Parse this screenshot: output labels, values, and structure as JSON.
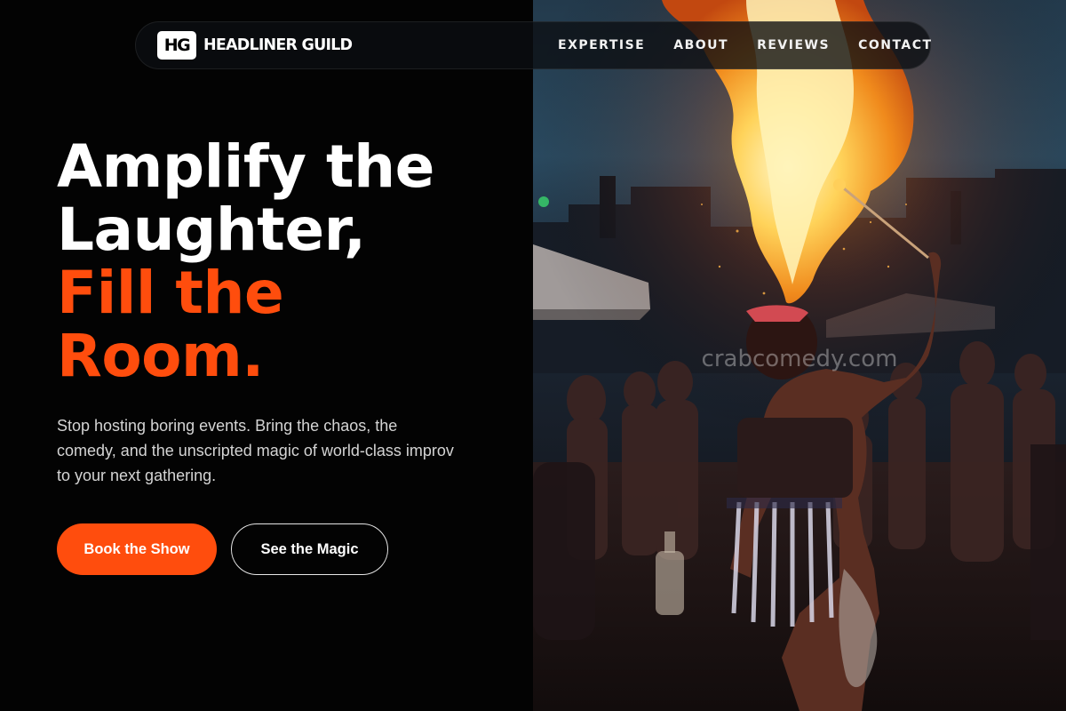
{
  "brand": {
    "mark": "HG",
    "name": "HEADLINER GUILD"
  },
  "nav": {
    "items": [
      {
        "label": "EXPERTISE"
      },
      {
        "label": "ABOUT"
      },
      {
        "label": "REVIEWS"
      },
      {
        "label": "CONTACT"
      }
    ]
  },
  "hero": {
    "headline_line1": "Amplify the",
    "headline_line2": "Laughter,",
    "headline_line3": "Fill the",
    "headline_line4": "Room.",
    "tagline": "Stop hosting boring events. Bring the chaos, the comedy, and the unscripted magic of world-class improv to your next gathering.",
    "primary_cta": "Book the Show",
    "secondary_cta": "See the Magic"
  },
  "image": {
    "description_icon": "fire-breather-photo",
    "watermark": "crabcomedy.com"
  },
  "colors": {
    "accent": "#ff4d0d",
    "background": "#030303",
    "text": "#ffffff",
    "muted_text": "#d4d4d4"
  }
}
